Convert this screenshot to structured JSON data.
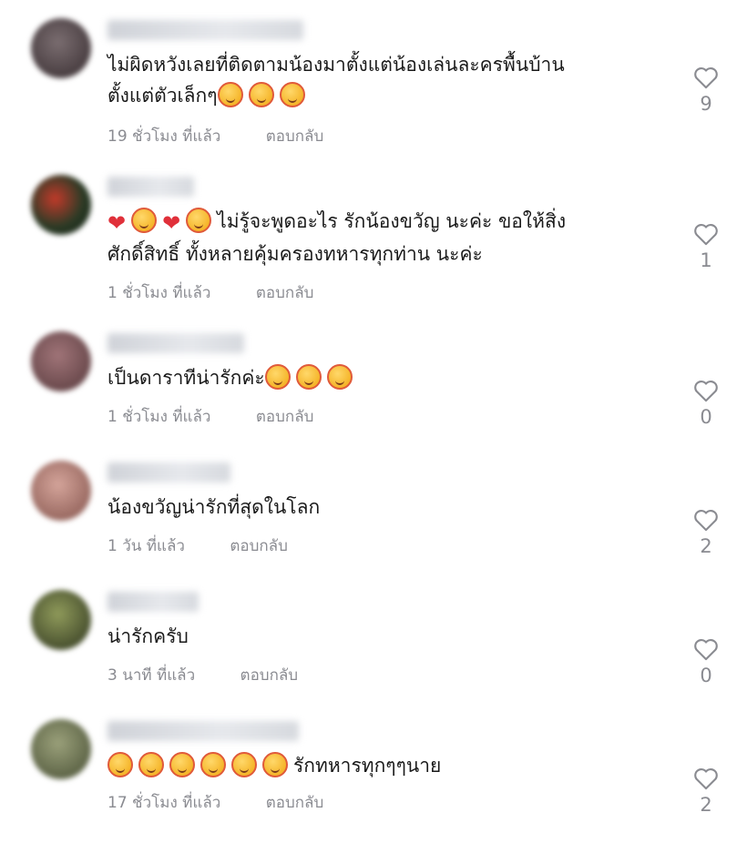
{
  "comments": [
    {
      "text_lines": [
        "ไม่ผิดหวังเลยที่ติดตามน้องมาตั้งแต่น้องเล่นละครพื้นบ้าน",
        "ตั้งแต่ตัวเล็กๆ"
      ],
      "emoji_count": 3,
      "time": "19 ชั่วโมง ที่แล้ว",
      "reply": "ตอบกลับ",
      "likes": "9",
      "avatar_color": "#5a4f52"
    },
    {
      "text_lines": [
        "ไม่รู้จะพูดอะไร รักน้องขวัญ นะค่ะ ขอให้สิ่ง",
        "ศักดิ์สิทธิ์ ทั้งหลายคุ้มครองทหารทุกท่าน นะค่ะ"
      ],
      "time": "1 ชั่วโมง ที่แล้ว",
      "reply": "ตอบกลับ",
      "likes": "1",
      "avatar_color": "#2f4a2e"
    },
    {
      "text": "เป็นดาราทีน่ารักค่ะ",
      "time": "1 ชั่วโมง ที่แล้ว",
      "reply": "ตอบกลับ",
      "likes": "0",
      "avatar_color": "#8a5a5e"
    },
    {
      "text": "น้องขวัญน่ารักที่สุดในโลก",
      "time": "1 วัน ที่แล้ว",
      "reply": "ตอบกลับ",
      "likes": "2",
      "avatar_color": "#b07a72"
    },
    {
      "text": "น่ารักครับ",
      "time": "3 นาที ที่แล้ว",
      "reply": "ตอบกลับ",
      "likes": "0",
      "avatar_color": "#5e6a3e"
    },
    {
      "text": "รักทหารทุกๆๆนาย",
      "time": "17 ชั่วโมง ที่แล้ว",
      "reply": "ตอบกลับ",
      "likes": "2",
      "avatar_color": "#6f7654"
    }
  ]
}
